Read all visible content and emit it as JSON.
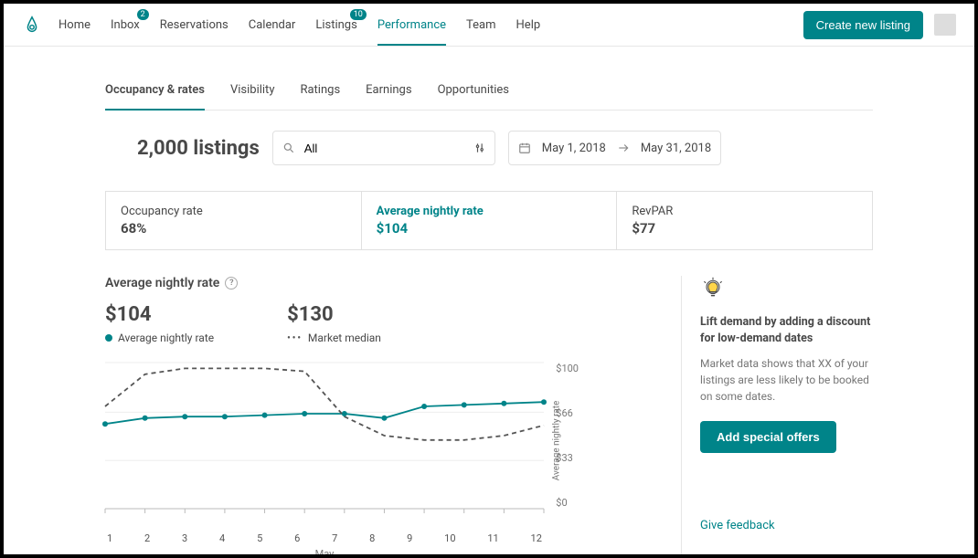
{
  "nav": {
    "items": [
      {
        "label": "Home"
      },
      {
        "label": "Inbox",
        "badge": "2"
      },
      {
        "label": "Reservations"
      },
      {
        "label": "Calendar"
      },
      {
        "label": "Listings",
        "badge": "10"
      },
      {
        "label": "Performance",
        "active": true
      },
      {
        "label": "Team"
      },
      {
        "label": "Help"
      }
    ],
    "cta": "Create new listing"
  },
  "subtabs": [
    {
      "label": "Occupancy & rates",
      "active": true
    },
    {
      "label": "Visibility"
    },
    {
      "label": "Ratings"
    },
    {
      "label": "Earnings"
    },
    {
      "label": "Opportunities"
    }
  ],
  "page_title": "2,000 listings",
  "filter": {
    "search_value": "All",
    "date_start": "May 1, 2018",
    "date_end": "May 31, 2018"
  },
  "cards": [
    {
      "label": "Occupancy rate",
      "value": "68%"
    },
    {
      "label": "Average nightly rate",
      "value": "$104",
      "active": true
    },
    {
      "label": "RevPAR",
      "value": "$77"
    }
  ],
  "section": {
    "title": "Average nightly rate",
    "fig1_value": "$104",
    "fig1_label": "Average nightly rate",
    "fig2_value": "$130",
    "fig2_label": "Market median"
  },
  "side": {
    "heading": "Lift demand by adding a discount for low-demand dates",
    "body": "Market data shows that XX of your listings are less likely to be booked on some dates.",
    "button": "Add special offers",
    "feedback": "Give feedback"
  },
  "chart_data": {
    "type": "line",
    "title": "Average nightly rate",
    "xlabel": "May",
    "ylabel": "Average nightly rate",
    "ylim": [
      0,
      100
    ],
    "yticks": [
      0,
      33,
      66,
      100
    ],
    "categories": [
      "1",
      "2",
      "3",
      "4",
      "5",
      "6",
      "7",
      "8",
      "9",
      "10",
      "11",
      "12"
    ],
    "series": [
      {
        "name": "Average nightly rate",
        "style": "solid",
        "color": "#008489",
        "values": [
          58,
          62,
          63,
          63,
          64,
          65,
          65,
          62,
          70,
          71,
          72,
          73
        ]
      },
      {
        "name": "Market median",
        "style": "dashed",
        "color": "#555",
        "values": [
          70,
          92,
          96,
          96,
          96,
          94,
          63,
          50,
          47,
          47,
          50,
          57
        ]
      }
    ]
  }
}
